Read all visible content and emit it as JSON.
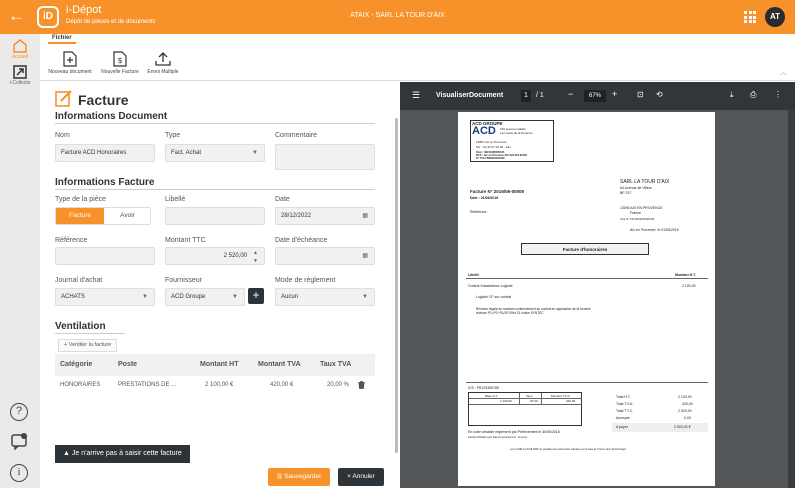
{
  "topbar": {
    "back_icon": "←",
    "logo": "iD",
    "app_name": "i-Dépot",
    "app_subtitle": "Dépôt de pièces et de documents",
    "center_title": "ATAIX - SARL LA TOUR D'AIX",
    "avatar": "AT",
    "accent": "#f7922a"
  },
  "sidebar": {
    "items": [
      {
        "label": "Accueil",
        "icon": "home-icon"
      },
      {
        "label": "i-Collecte",
        "icon": "export-icon"
      }
    ],
    "bottom": [
      {
        "icon": "help-icon",
        "glyph": "?"
      },
      {
        "icon": "chat-icon"
      },
      {
        "icon": "info-icon",
        "glyph": "i"
      }
    ]
  },
  "ribbon": {
    "tab": "Fichier",
    "buttons": [
      {
        "label": "Nouveau document",
        "icon": "new-doc-icon"
      },
      {
        "label": "Nouvelle Facture",
        "icon": "invoice-icon"
      },
      {
        "label": "Envoi Multiple",
        "icon": "upload-icon"
      }
    ]
  },
  "form": {
    "title": "Facture",
    "section_document": "Informations Document",
    "nom_label": "Nom",
    "nom_value": "Facture ACD Honoraires",
    "type_label": "Type",
    "type_value": "Fact. Achat",
    "commentaire_label": "Commentaire",
    "section_facture": "Informations Facture",
    "type_piece_label": "Type de la pièce",
    "toggle_facture": "Facture",
    "toggle_avoir": "Avoir",
    "libelle_label": "Libellé",
    "date_label": "Date",
    "date_value": "28/12/2022",
    "reference_label": "Référence",
    "montant_label": "Montant TTC",
    "montant_value": "2 520,00",
    "echeance_label": "Date d'échéance",
    "journal_label": "Journal d'achat",
    "journal_value": "ACHATS",
    "fournisseur_label": "Fournisseur",
    "fournisseur_value": "ACD Groupe",
    "mode_label": "Mode de règlement",
    "mode_value": "Aucun",
    "section_ventilation": "Ventilation",
    "ventiler_button": "+ Ventiler la facture",
    "table_headers": [
      "Catégorie",
      "Poste",
      "Montant HT",
      "Montant TVA",
      "Taux TVA"
    ],
    "table_row": [
      "HONORAIRES",
      "PRESTATIONS DE ...",
      "2 100,00 €",
      "420,00 €",
      "20,00 %"
    ],
    "alert_button": "Je n'arrive pas à saisir cette facture",
    "save_button": "Sauvegarder",
    "cancel_button": "× Annuler"
  },
  "viewer": {
    "title": "VisualiserDocument",
    "page_current": "1",
    "page_total": "/ 1",
    "zoom": "67%",
    "doc": {
      "company": "ACD GROUPE",
      "logo": "ACD",
      "addr1": "165 avenue Galilée",
      "addr2": "Les hauts de la Duranne",
      "addr3": "13857 Aix en Provence",
      "tel": "Tel. : 04 42 97 00 00  - Fax",
      "siret": "Siret : 39152466500105",
      "rcs": "RCS : Aix en Provence 391 524 662 00105",
      "tva_no": "N° TVA FR09391524662",
      "invoice_no": "Facture N° 2016/06-00000",
      "invoice_date": "Date : 01/06/2016",
      "reference": "Référence :",
      "client_name": "SARL LA TOUR D'AIX",
      "client_addr1": "64 Avenue de Villers",
      "client_addr2": "BP 237",
      "client_addr3": "13090 AIX EN PROVENCE",
      "client_country": "France",
      "client_tva": "Intra N° TVA FR09225466799",
      "place_date": "Aix en Provence, le 01/06/2016",
      "box_title": "Facture d'honoraires",
      "col_libelle": "Libellé",
      "col_montant": "Montant H.T.",
      "line1": "Contrat d'assistance Logiciel",
      "line1_amount": "2 100,00",
      "line2": "Logiciel  CF sur contrat",
      "line3": "Révision légale du montant conformément au contrat en application de la formule",
      "line4": "révision P1=P0 *S1/S0          S0et S1 indice SYNTEC",
      "ics": "ICS : FR123456789",
      "tva_headers": [
        "Base H.T.",
        "Taux",
        "Montant T.V.A."
      ],
      "tva_values": [
        "2 100,00",
        "20.00",
        "420,00"
      ],
      "totals": [
        {
          "label": "Total H.T.",
          "value": "2 100,00"
        },
        {
          "label": "Total T.V.A.",
          "value": "420,00"
        },
        {
          "label": "Total T.T.C.",
          "value": "2 520,00"
        },
        {
          "label": "Acompte",
          "value": "0,00"
        },
        {
          "label": "A payer",
          "value": "2 520,00 €"
        }
      ],
      "payment_note": "En votre aimable règlement par Prélèvement le 30/06/2016",
      "interest_note": "Intérêts forfaitaire pour frais de recouvrement : 40 euros",
      "legal_note": "La Loi LME du 04.08.2008, les pénalités de retard seront calculées sur la base de 3 fois le taux d'intérêt légal"
    }
  }
}
